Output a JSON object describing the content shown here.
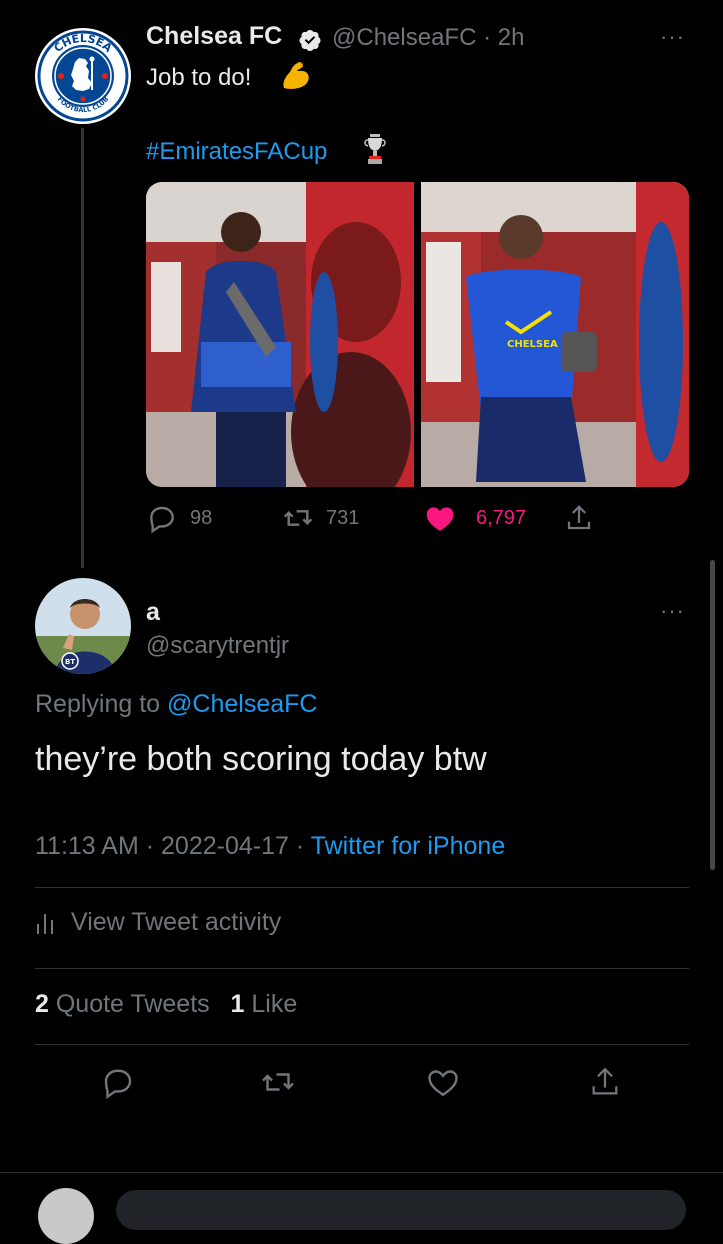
{
  "tweet": {
    "author_name": "Chelsea FC",
    "handle": "@ChelseaFC",
    "separator": "·",
    "time_ago": "2h",
    "text": "Job to do!",
    "hashtag": "#EmiratesFACup",
    "more": "···",
    "replies": "98",
    "retweets": "731",
    "likes": "6,797",
    "liked": true,
    "crest_text_top": "CHELSEA",
    "crest_text_bottom": "FOOTBALL CLUB",
    "shirt_text": "CHELSEA FC"
  },
  "reply": {
    "author_name": "a",
    "handle": "@scarytrentjr",
    "more": "···",
    "replying_label": "Replying to",
    "replying_handle": "@ChelseaFC",
    "text": "they’re both scoring today btw",
    "time": "11:13 AM",
    "dot": "·",
    "date": "2022-04-17",
    "dot2": "·",
    "source": "Twitter for iPhone",
    "activity_label": "View Tweet activity",
    "quote_count": "2",
    "quote_label": "Quote Tweets",
    "like_count": "1",
    "like_label": "Like",
    "avatar_badge": "BT"
  },
  "colors": {
    "background": "#000000",
    "muted": "#71767b",
    "link": "#1d9bf0",
    "like": "#f91880",
    "chelsea_blue": "#034694"
  },
  "icons": [
    "verified-icon",
    "muscle-emoji",
    "trophy-emoji",
    "reply-icon",
    "retweet-icon",
    "heart-icon",
    "share-icon",
    "activity-icon"
  ]
}
